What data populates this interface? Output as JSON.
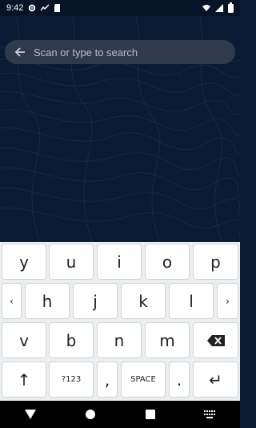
{
  "status_bar": {
    "time": "9:42",
    "icons_left": [
      "gear-icon",
      "activity-icon",
      "sdcard-icon"
    ],
    "icons_right": [
      "wifi-icon",
      "signal-icon",
      "battery-icon"
    ]
  },
  "search": {
    "placeholder": "Scan or type to search",
    "back_icon": "arrow-left-icon"
  },
  "keyboard": {
    "row1": [
      "y",
      "u",
      "i",
      "o",
      "p"
    ],
    "row2": [
      "‹",
      "h",
      "j",
      "k",
      "l",
      "›"
    ],
    "row3": [
      "v",
      "b",
      "n",
      "m"
    ],
    "row3_delete_icon": "backspace-icon",
    "row4": {
      "shift": "↑",
      "symbols": "?123",
      "comma": ",",
      "space": "SPACE",
      "period": ".",
      "enter": "↵"
    }
  },
  "nav_bar": {
    "back_icon": "triangle-back-icon",
    "home_icon": "circle-home-icon",
    "recents_icon": "square-recents-icon",
    "keyboard_icon": "keyboard-switch-icon"
  },
  "colors": {
    "background": "#0b1b35",
    "search_bar": "#2f3a4c",
    "keyboard_bg": "#eceff1",
    "key_bg": "#ffffff"
  }
}
